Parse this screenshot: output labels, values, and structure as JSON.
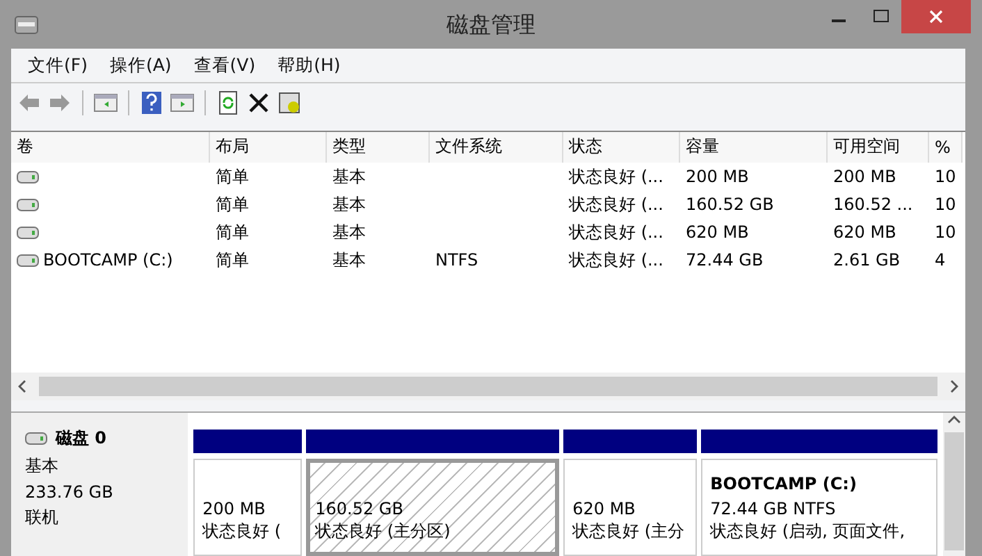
{
  "window": {
    "title": "磁盘管理"
  },
  "menu": [
    "文件(F)",
    "操作(A)",
    "查看(V)",
    "帮助(H)"
  ],
  "table": {
    "columns": [
      "卷",
      "布局",
      "类型",
      "文件系统",
      "状态",
      "容量",
      "可用空间",
      "%"
    ],
    "rows": [
      [
        "",
        "简单",
        "基本",
        "",
        "状态良好 (...",
        "200 MB",
        "200 MB",
        "10"
      ],
      [
        "",
        "简单",
        "基本",
        "",
        "状态良好 (...",
        "160.52 GB",
        "160.52 ...",
        "10"
      ],
      [
        "",
        "简单",
        "基本",
        "",
        "状态良好 (...",
        "620 MB",
        "620 MB",
        "10"
      ],
      [
        "BOOTCAMP (C:)",
        "简单",
        "基本",
        "NTFS",
        "状态良好 (...",
        "72.44 GB",
        "2.61 GB",
        "4"
      ]
    ]
  },
  "disk": {
    "name": "磁盘 0",
    "type": "基本",
    "size": "233.76 GB",
    "status": "联机",
    "partitions": [
      {
        "size": "200 MB",
        "status": "状态良好 (",
        "selected": false
      },
      {
        "size": "160.52 GB",
        "status": "状态良好 (主分区)",
        "selected": true
      },
      {
        "size": "620 MB",
        "status": "状态良好 (主分",
        "selected": false
      },
      {
        "title": "BOOTCAMP  (C:)",
        "size": "72.44 GB NTFS",
        "status": "状态良好 (启动, 页面文件,",
        "selected": false
      }
    ]
  }
}
